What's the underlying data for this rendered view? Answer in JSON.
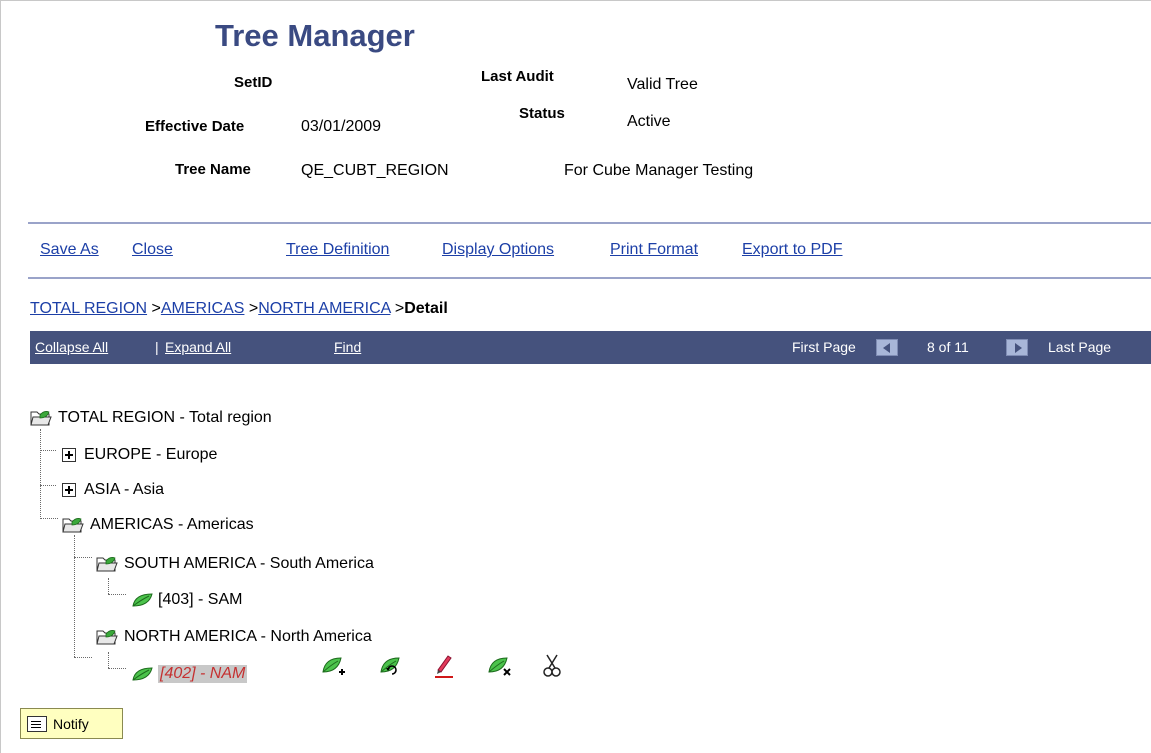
{
  "header": {
    "title": "Tree Manager",
    "setid_label": "SetID",
    "setid_value": "",
    "effective_date_label": "Effective Date",
    "effective_date_value": "03/01/2009",
    "tree_name_label": "Tree Name",
    "tree_name_value": "QE_CUBT_REGION",
    "tree_description": "For Cube Manager Testing",
    "last_audit_label": "Last Audit",
    "last_audit_value": "Valid Tree",
    "status_label": "Status",
    "status_value": "Active"
  },
  "toolbar": {
    "save_as": "Save As",
    "close": "Close",
    "tree_definition": "Tree Definition",
    "display_options": "Display Options",
    "print_format": "Print Format",
    "export_pdf": "Export to PDF"
  },
  "breadcrumb": {
    "items": [
      "TOTAL REGION",
      "AMERICAS",
      "NORTH AMERICA"
    ],
    "separator": ">",
    "current": "Detail"
  },
  "navbar": {
    "collapse_all": "Collapse All",
    "divider": "|",
    "expand_all": "Expand All",
    "find": "Find",
    "first_page": "First Page",
    "page_info": "8 of 11",
    "last_page": "Last Page"
  },
  "tree": {
    "root": "TOTAL REGION - Total region",
    "europe": "EUROPE - Europe",
    "asia": "ASIA - Asia",
    "americas": "AMERICAS - Americas",
    "south_america": "SOUTH AMERICA - South America",
    "sam_detail": "[403] - SAM",
    "north_america": "NORTH AMERICA - North America",
    "nam_detail": "[402] - NAM"
  },
  "notify": {
    "label": "Notify"
  },
  "colors": {
    "title": "#3a4a82",
    "link": "#1c3fa7",
    "navbar_bg": "#45527d",
    "selected_text": "#c53030",
    "leaf_green": "#2e9a2e",
    "notify_bg": "#ffffc0"
  }
}
